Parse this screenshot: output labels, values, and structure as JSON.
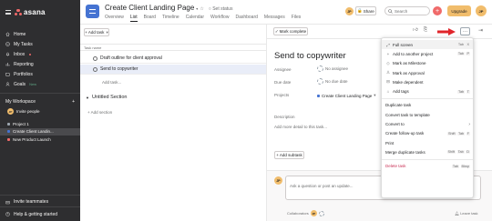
{
  "sidebar": {
    "logo": "asana",
    "nav": [
      {
        "label": "Home",
        "icon": "home-icon"
      },
      {
        "label": "My Tasks",
        "icon": "check-circle-icon"
      },
      {
        "label": "Inbox",
        "icon": "bell-icon"
      },
      {
        "label": "Reporting",
        "icon": "chart-icon"
      },
      {
        "label": "Portfolios",
        "icon": "folder-icon"
      },
      {
        "label": "Goals",
        "icon": "person-icon",
        "badge": "New"
      }
    ],
    "workspace": {
      "label": "My Workspace",
      "invite": "Invite people",
      "avatar": "JP"
    },
    "projects": [
      {
        "label": "Project 1",
        "color": "#9ca6af"
      },
      {
        "label": "Create Client Landin...",
        "color": "#4573d2"
      },
      {
        "label": "New Product Launch",
        "color": "#f06a6a"
      }
    ],
    "invite_teammates": "Invite teammates",
    "help": "Help & getting started"
  },
  "header": {
    "title": "Create Client Landing Page",
    "set_status": "Set status",
    "tabs": [
      "Overview",
      "List",
      "Board",
      "Timeline",
      "Calendar",
      "Workflow",
      "Dashboard",
      "Messages",
      "Files"
    ],
    "active_tab": "List",
    "share": "Share",
    "search_placeholder": "Search",
    "upgrade": "Upgrade",
    "user_initials": "JP"
  },
  "list": {
    "add_task": "+ Add task",
    "column_header": "Task name",
    "tasks": [
      {
        "name": "Draft outline for client approval"
      },
      {
        "name": "Send to copywriter",
        "selected": true
      }
    ],
    "add_task_inline": "Add task...",
    "section": "Untitled Section",
    "add_section": "+ Add section"
  },
  "detail": {
    "mark_complete": "Mark complete",
    "title": "Send to copywriter",
    "fields": [
      {
        "label": "Assignee",
        "value": "No assignee"
      },
      {
        "label": "Due date",
        "value": "No due date"
      },
      {
        "label": "Projects",
        "value": "Create Client Landing Page"
      }
    ],
    "description_label": "Description",
    "description_placeholder": "Add more detail to this task...",
    "add_subtask": "+ Add subtask",
    "comment_placeholder": "Ask a question or post an update...",
    "collaborators_label": "Collaborators",
    "leave_task": "Leave task",
    "user_initials": "JP"
  },
  "menu": {
    "items": [
      {
        "label": "Full screen",
        "icon": "expand-icon",
        "keys": [
          "Tab",
          "X"
        ]
      },
      {
        "label": "Add to another project",
        "icon": "plus-icon",
        "keys": [
          "Tab",
          "P"
        ]
      },
      {
        "label": "Mark as Milestone",
        "icon": "diamond-icon",
        "keys": []
      },
      {
        "label": "Mark as Approval",
        "icon": "approval-icon",
        "keys": []
      },
      {
        "label": "Make dependent",
        "icon": "dependent-icon",
        "keys": []
      },
      {
        "label": "Add tags",
        "icon": "tag-icon",
        "keys": [
          "Tab",
          "T"
        ]
      },
      {
        "label": "Duplicate task",
        "keys": []
      },
      {
        "label": "Convert task to template",
        "keys": []
      },
      {
        "label": "Convert to",
        "keys": [],
        "submenu": true
      },
      {
        "label": "Create follow-up task",
        "keys": [
          "Shift",
          "Tab",
          "F"
        ]
      },
      {
        "label": "Print",
        "keys": []
      },
      {
        "label": "Merge duplicate tasks",
        "keys": [
          "Shift",
          "Tab",
          "D"
        ]
      },
      {
        "label": "Delete task",
        "keys": [
          "Tab",
          "Bksp"
        ],
        "danger": true
      }
    ]
  },
  "colors": {
    "sidebar_bg": "#2e2e30",
    "accent_blue": "#4573d2",
    "asana_coral": "#f06a6a",
    "upgrade_yellow": "#f1bd6c",
    "selected_row": "#e9edf8",
    "danger_red": "#c92f54"
  }
}
